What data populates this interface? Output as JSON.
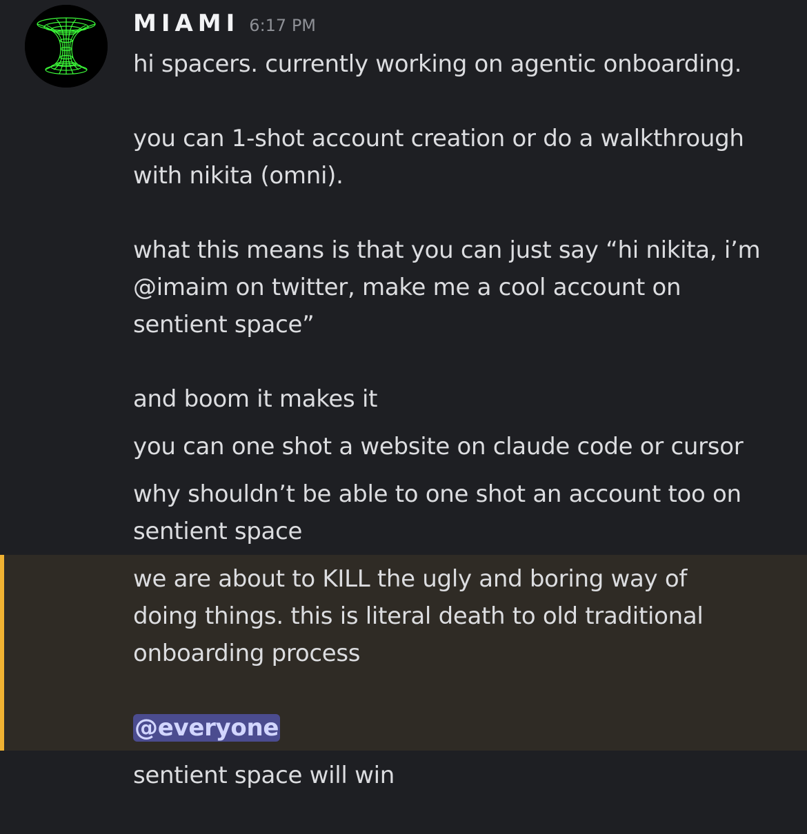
{
  "message": {
    "author": "MIAMI",
    "timestamp": "6:17 PM",
    "lines": [
      "hi spacers. currently working on agentic onboarding.",
      "you can 1-shot account creation or do a walkthrough",
      "with nikita (omni).",
      "what this means is that you can just say “hi nikita, i’m",
      "@imaim on twitter, make me a cool account on",
      "sentient space”",
      "and boom it makes it",
      "you can one shot a website on claude code or cursor",
      "why shouldn’t be able to one shot an account too on",
      "sentient space",
      "we are about to KILL the ugly and boring way of",
      "doing things. this is literal death to old traditional",
      "onboarding process",
      "sentient space will win"
    ],
    "mention": "@everyone"
  },
  "colors": {
    "background": "#1e1f23",
    "mention_highlight_bg": "#2f2b25",
    "mention_bar": "#f0b232",
    "mention_pill": "#4b4c8f",
    "avatar_accent": "#3dff3a"
  },
  "icons": {
    "avatar": "green-wireframe-wormhole-icon"
  }
}
